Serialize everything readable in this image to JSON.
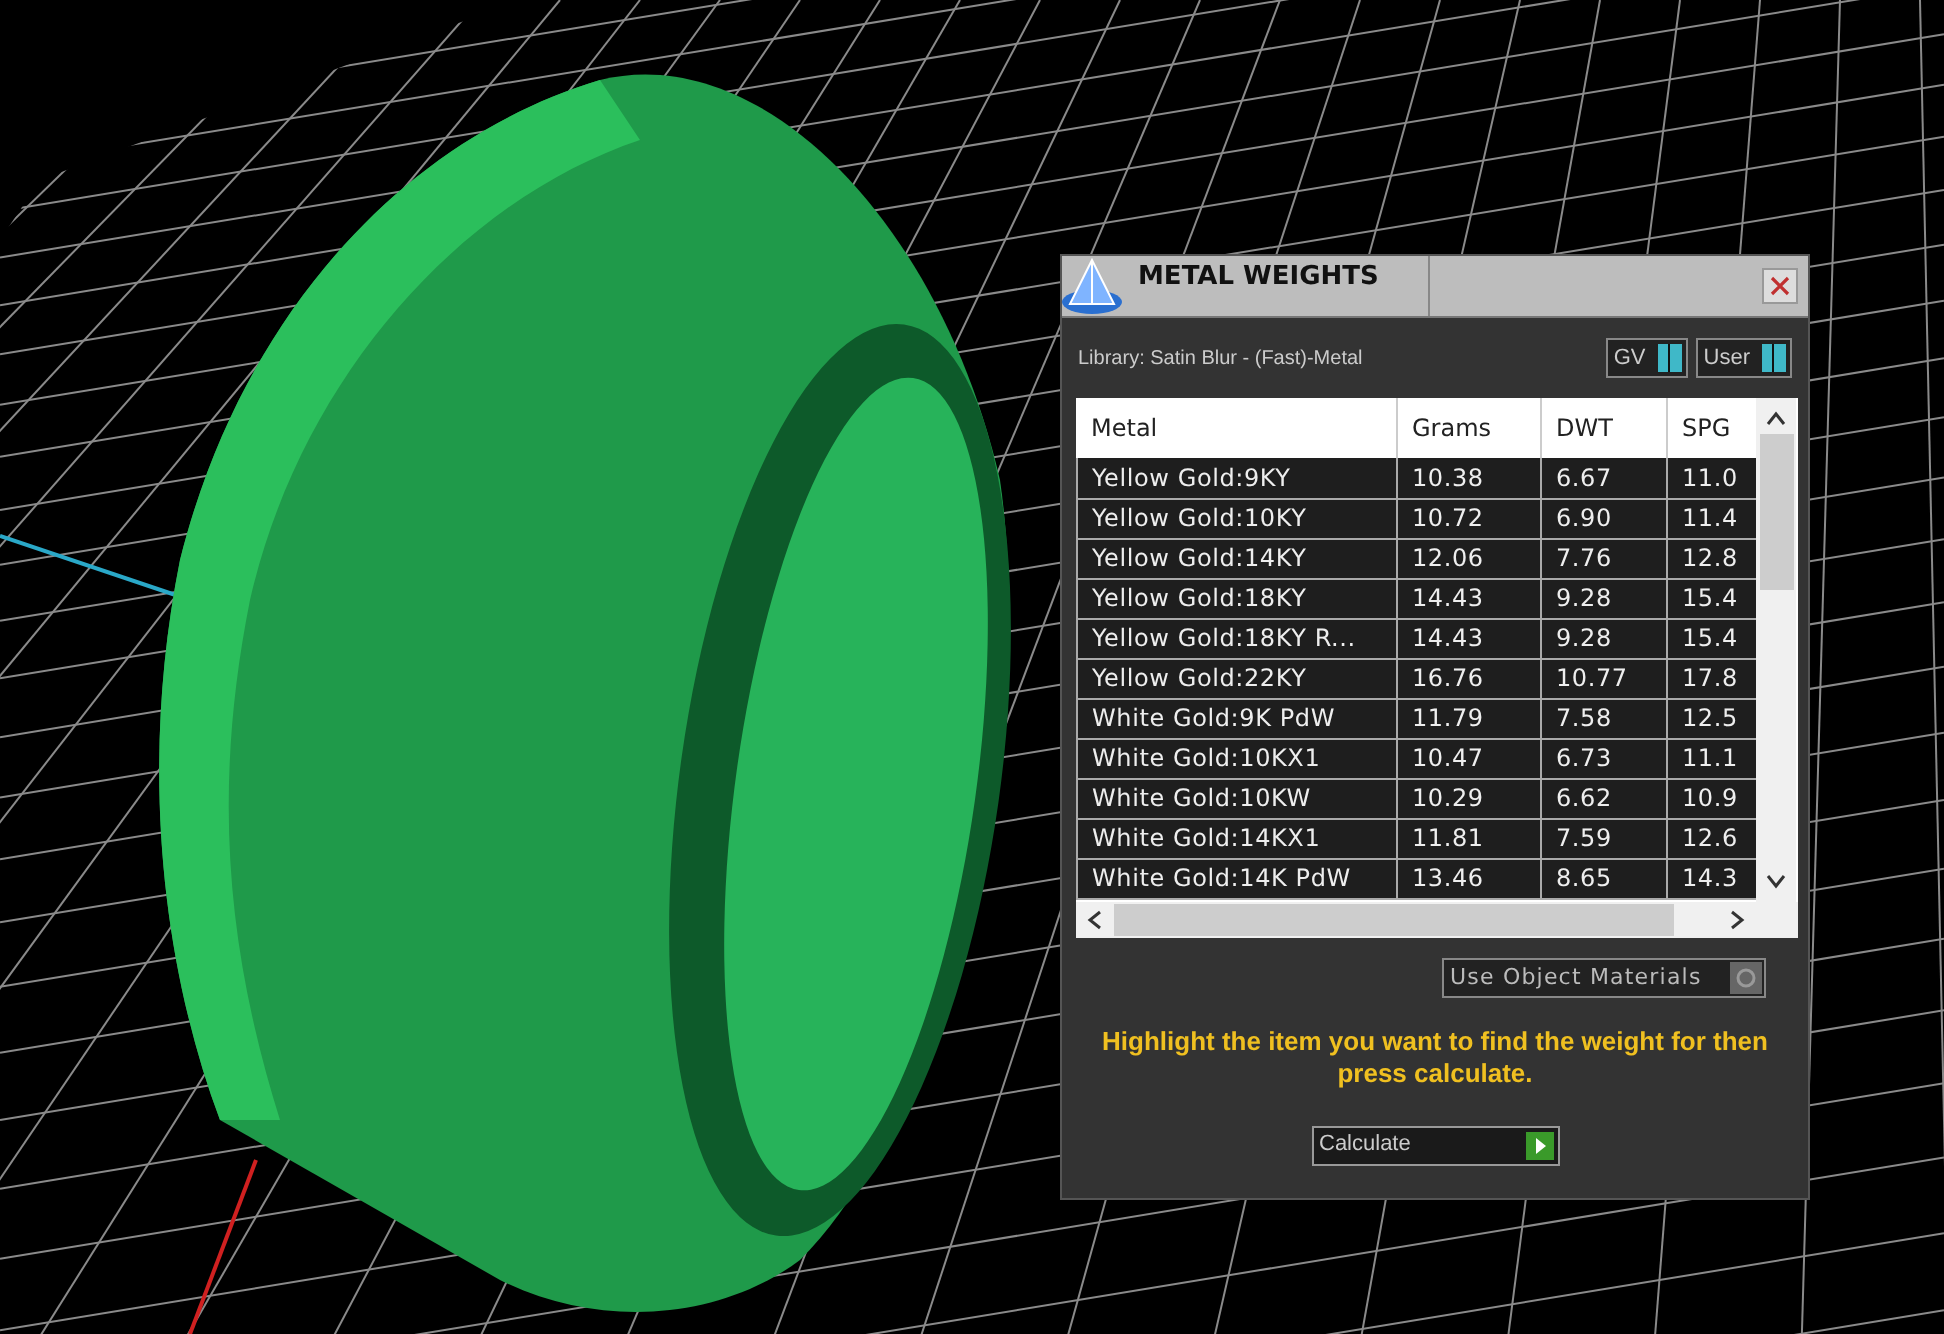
{
  "panel": {
    "title": "METAL WEIGHTS",
    "library": "Library: Satin Blur - (Fast)-Metal",
    "toggles": [
      {
        "label": "GV",
        "on": true
      },
      {
        "label": "User",
        "on": true
      }
    ],
    "table": {
      "columns": [
        "Metal",
        "Grams",
        "DWT",
        "SPG"
      ],
      "rows": [
        [
          "Yellow Gold:9KY",
          "10.38",
          "6.67",
          "11.0"
        ],
        [
          "Yellow Gold:10KY",
          "10.72",
          "6.90",
          "11.4"
        ],
        [
          "Yellow Gold:14KY",
          "12.06",
          "7.76",
          "12.8"
        ],
        [
          "Yellow Gold:18KY",
          "14.43",
          "9.28",
          "15.4"
        ],
        [
          "Yellow Gold:18KY R...",
          "14.43",
          "9.28",
          "15.4"
        ],
        [
          "Yellow Gold:22KY",
          "16.76",
          "10.77",
          "17.8"
        ],
        [
          "White Gold:9K PdW",
          "11.79",
          "7.58",
          "12.5"
        ],
        [
          "White Gold:10KX1",
          "10.47",
          "6.73",
          "11.1"
        ],
        [
          "White Gold:10KW",
          "10.29",
          "6.62",
          "10.9"
        ],
        [
          "White Gold:14KX1",
          "11.81",
          "7.59",
          "12.6"
        ],
        [
          "White Gold:14K PdW",
          "13.46",
          "8.65",
          "14.3"
        ]
      ]
    },
    "materials_toggle": {
      "label": "Use Object Materials",
      "on": false
    },
    "hint": "Highlight the item you want to find the weight for then press calculate.",
    "calculate_button": "Calculate"
  }
}
